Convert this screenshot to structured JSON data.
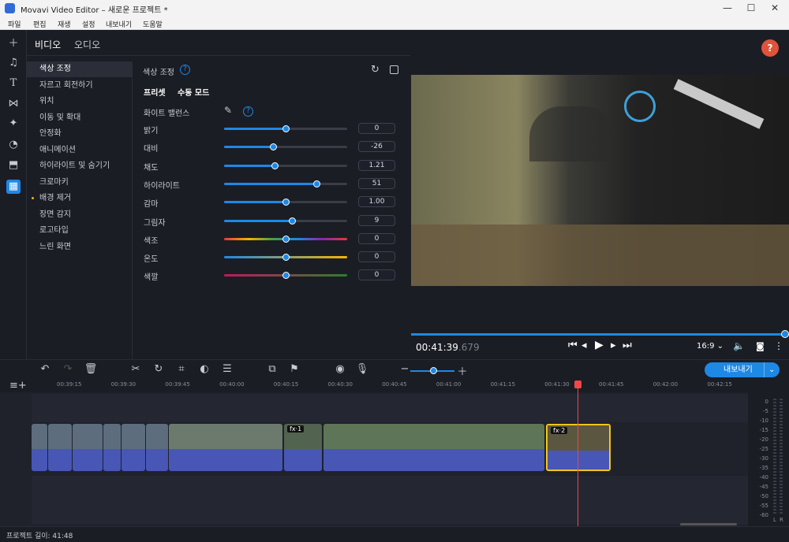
{
  "window": {
    "title": "Movavi Video Editor – 새로운 프로젝트 *",
    "min": "—",
    "max": "☐",
    "close": "✕"
  },
  "menu": [
    "파일",
    "편집",
    "재생",
    "설정",
    "내보내기",
    "도움말"
  ],
  "left_tools": [
    "plus-icon",
    "music-icon",
    "text-icon",
    "transition-icon",
    "sticker-icon",
    "clock-icon",
    "export-icon",
    "effects-icon"
  ],
  "panel": {
    "tabs": [
      "비디오",
      "오디오"
    ],
    "categories": [
      {
        "label": "색상 조정",
        "selected": true,
        "dot": false
      },
      {
        "label": "자르고 회전하기",
        "dot": false
      },
      {
        "label": "위치",
        "dot": false
      },
      {
        "label": "이동 및 확대",
        "dot": false
      },
      {
        "label": "안정화",
        "dot": false
      },
      {
        "label": "애니메이션",
        "dot": false
      },
      {
        "label": "하이라이트 및 숨기기",
        "dot": false
      },
      {
        "label": "크로마키",
        "dot": false
      },
      {
        "label": "배경 제거",
        "dot": true
      },
      {
        "label": "장면 감지",
        "dot": false
      },
      {
        "label": "로고타입",
        "dot": false
      },
      {
        "label": "느린 화면",
        "dot": false
      }
    ],
    "section_title": "색상 조정",
    "mode_tabs": [
      "프리셋",
      "수동 모드"
    ],
    "white_balance": "화이트 밸런스",
    "sliders": [
      {
        "label": "밝기",
        "value": "0",
        "pos": 0.5,
        "track": "default"
      },
      {
        "label": "대비",
        "value": "-26",
        "pos": 0.4,
        "track": "default"
      },
      {
        "label": "채도",
        "value": "1.21",
        "pos": 0.41,
        "track": "default"
      },
      {
        "label": "하이라이트",
        "value": "51",
        "pos": 0.75,
        "track": "default"
      },
      {
        "label": "감마",
        "value": "1.00",
        "pos": 0.5,
        "track": "default"
      },
      {
        "label": "그림자",
        "value": "9",
        "pos": 0.55,
        "track": "default"
      },
      {
        "label": "색조",
        "value": "0",
        "pos": 0.5,
        "track": "hue"
      },
      {
        "label": "온도",
        "value": "0",
        "pos": 0.5,
        "track": "temp"
      },
      {
        "label": "색깔",
        "value": "0",
        "pos": 0.5,
        "track": "tint"
      }
    ]
  },
  "preview": {
    "time_main": "00:41:39",
    "time_frac": ".679",
    "aspect": "16:9",
    "progress": 1.0,
    "help_label": "?"
  },
  "timeline": {
    "export_label": "내보내기",
    "ruler_ticks": [
      "00:39:15",
      "00:39:30",
      "00:39:45",
      "00:40:00",
      "00:40:15",
      "00:40:30",
      "00:40:45",
      "00:41:00",
      "00:41:15",
      "00:41:30",
      "00:41:45",
      "00:42:00",
      "00:42:15"
    ],
    "fx_labels": [
      "fx·1",
      "fx·2"
    ],
    "db_scale": [
      "0",
      "-5",
      "-10",
      "-15",
      "-20",
      "-25",
      "-30",
      "-35",
      "-40",
      "-45",
      "-50",
      "-55",
      "-60"
    ],
    "meter_channels": [
      "L",
      "R"
    ]
  },
  "status": {
    "project_length": "프로젝트 길이: 41:48"
  },
  "colors": {
    "accent": "#1e88e5",
    "help": "#e0533a",
    "playhead": "#f04848",
    "selected_clip": "#f5c518"
  }
}
